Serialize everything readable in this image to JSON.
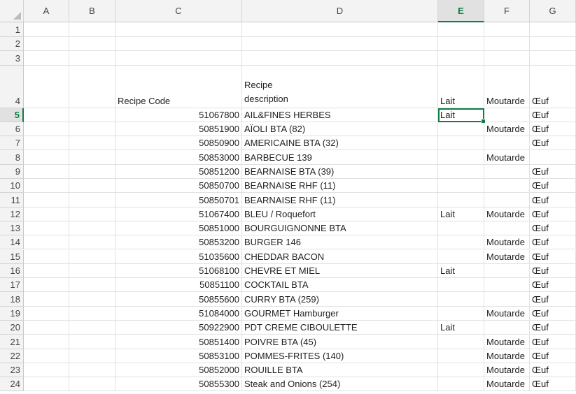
{
  "columns": [
    "A",
    "B",
    "C",
    "D",
    "E",
    "F",
    "G"
  ],
  "header_row": {
    "row_number": "4",
    "recipe_code": "Recipe Code",
    "recipe_description_line1": "Recipe",
    "recipe_description_line2": "description",
    "lait": "Lait",
    "moutarde": "Moutarde",
    "oeuf": "Œuf"
  },
  "empty_rows": [
    "1",
    "2",
    "3"
  ],
  "rows": [
    {
      "n": "5",
      "code": "51067800",
      "desc": "AIL&FINES HERBES",
      "lait": "Lait",
      "moutarde": "",
      "oeuf": "Œuf"
    },
    {
      "n": "6",
      "code": "50851900",
      "desc": "AÏOLI BTA (82)",
      "lait": "",
      "moutarde": "Moutarde",
      "oeuf": "Œuf"
    },
    {
      "n": "7",
      "code": "50850900",
      "desc": "AMERICAINE BTA  (32)",
      "lait": "",
      "moutarde": "",
      "oeuf": "Œuf"
    },
    {
      "n": "8",
      "code": "50853000",
      "desc": "BARBECUE 139",
      "lait": "",
      "moutarde": "Moutarde",
      "oeuf": ""
    },
    {
      "n": "9",
      "code": "50851200",
      "desc": "BEARNAISE BTA (39)",
      "lait": "",
      "moutarde": "",
      "oeuf": "Œuf"
    },
    {
      "n": "10",
      "code": "50850700",
      "desc": "BEARNAISE RHF (11)",
      "lait": "",
      "moutarde": "",
      "oeuf": "Œuf"
    },
    {
      "n": "11",
      "code": "50850701",
      "desc": "BEARNAISE RHF (11)",
      "lait": "",
      "moutarde": "",
      "oeuf": "Œuf"
    },
    {
      "n": "12",
      "code": "51067400",
      "desc": "BLEU / Roquefort",
      "lait": "Lait",
      "moutarde": "Moutarde",
      "oeuf": "Œuf"
    },
    {
      "n": "13",
      "code": "50851000",
      "desc": "BOURGUIGNONNE BTA",
      "lait": "",
      "moutarde": "",
      "oeuf": "Œuf"
    },
    {
      "n": "14",
      "code": "50853200",
      "desc": "BURGER 146",
      "lait": "",
      "moutarde": "Moutarde",
      "oeuf": "Œuf"
    },
    {
      "n": "15",
      "code": "51035600",
      "desc": "CHEDDAR BACON",
      "lait": "",
      "moutarde": "Moutarde",
      "oeuf": "Œuf"
    },
    {
      "n": "16",
      "code": "51068100",
      "desc": "CHEVRE ET MIEL",
      "lait": "Lait",
      "moutarde": "",
      "oeuf": "Œuf"
    },
    {
      "n": "17",
      "code": "50851100",
      "desc": "COCKTAIL BTA",
      "lait": "",
      "moutarde": "",
      "oeuf": "Œuf"
    },
    {
      "n": "18",
      "code": "50855600",
      "desc": "CURRY BTA (259)",
      "lait": "",
      "moutarde": "",
      "oeuf": "Œuf"
    },
    {
      "n": "19",
      "code": "51084000",
      "desc": "GOURMET Hamburger",
      "lait": "",
      "moutarde": "Moutarde",
      "oeuf": "Œuf"
    },
    {
      "n": "20",
      "code": "50922900",
      "desc": "PDT CREME CIBOULETTE",
      "lait": "Lait",
      "moutarde": "",
      "oeuf": "Œuf"
    },
    {
      "n": "21",
      "code": "50851400",
      "desc": "POIVRE BTA (45)",
      "lait": "",
      "moutarde": "Moutarde",
      "oeuf": "Œuf"
    },
    {
      "n": "22",
      "code": "50853100",
      "desc": "POMMES-FRITES (140)",
      "lait": "",
      "moutarde": "Moutarde",
      "oeuf": "Œuf"
    },
    {
      "n": "23",
      "code": "50852000",
      "desc": "ROUILLE BTA",
      "lait": "",
      "moutarde": "Moutarde",
      "oeuf": "Œuf"
    },
    {
      "n": "24",
      "code": "50855300",
      "desc": "Steak and Onions (254)",
      "lait": "",
      "moutarde": "Moutarde",
      "oeuf": "Œuf"
    }
  ],
  "selection": {
    "column": "E",
    "row": "5"
  },
  "colors": {
    "accent": "#107c41",
    "header_bg": "#f3f3f3",
    "grid": "#e1e1e1"
  }
}
